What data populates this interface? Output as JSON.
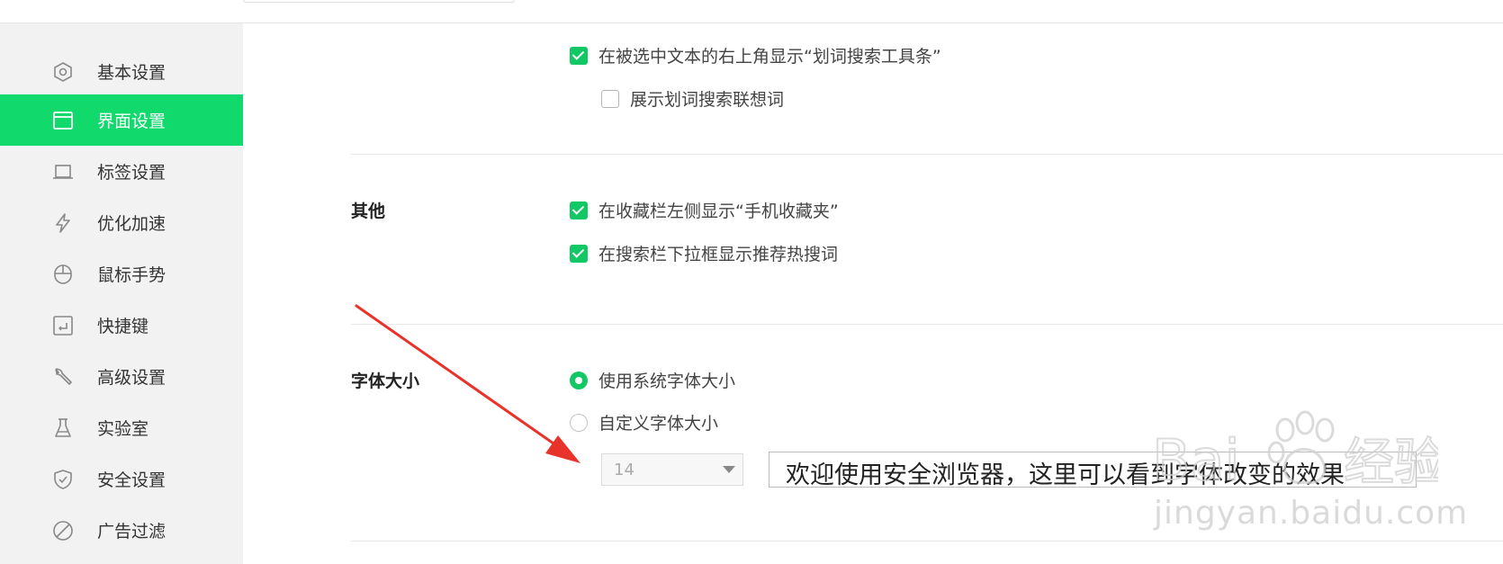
{
  "sidebar": {
    "items": [
      {
        "label": "基本设置",
        "icon": "hexagon-settings-icon"
      },
      {
        "label": "界面设置",
        "icon": "window-interface-icon",
        "active": true
      },
      {
        "label": "标签设置",
        "icon": "tab-label-icon"
      },
      {
        "label": "优化加速",
        "icon": "lightning-icon"
      },
      {
        "label": "鼠标手势",
        "icon": "mouse-icon"
      },
      {
        "label": "快捷键",
        "icon": "keyboard-shortcut-icon"
      },
      {
        "label": "高级设置",
        "icon": "wrench-icon"
      },
      {
        "label": "实验室",
        "icon": "flask-icon"
      },
      {
        "label": "安全设置",
        "icon": "shield-icon"
      },
      {
        "label": "广告过滤",
        "icon": "block-icon"
      }
    ],
    "active_color": "#12d96c"
  },
  "main": {
    "selection_search": {
      "show_toolbar": {
        "label": "在被选中文本的右上角显示“划词搜索工具条”",
        "checked": true
      },
      "show_suggestions": {
        "label": "展示划词搜索联想词",
        "checked": false
      }
    },
    "other": {
      "title": "其他",
      "options": [
        {
          "label": "在收藏栏左侧显示“手机收藏夹”",
          "checked": true
        },
        {
          "label": "在搜索栏下拉框显示推荐热搜词",
          "checked": true
        }
      ]
    },
    "font_size": {
      "title": "字体大小",
      "radio_system": {
        "label": "使用系统字体大小",
        "selected": true
      },
      "radio_custom": {
        "label": "自定义字体大小",
        "selected": false
      },
      "size_value": "14",
      "preview_text": "欢迎使用安全浏览器，这里可以看到字体改变的效果"
    }
  },
  "watermark": {
    "logo": "Bai du 经验",
    "url": "jingyan.baidu.com"
  },
  "colors": {
    "accent": "#12c864",
    "annotation_arrow": "#e8332a"
  }
}
